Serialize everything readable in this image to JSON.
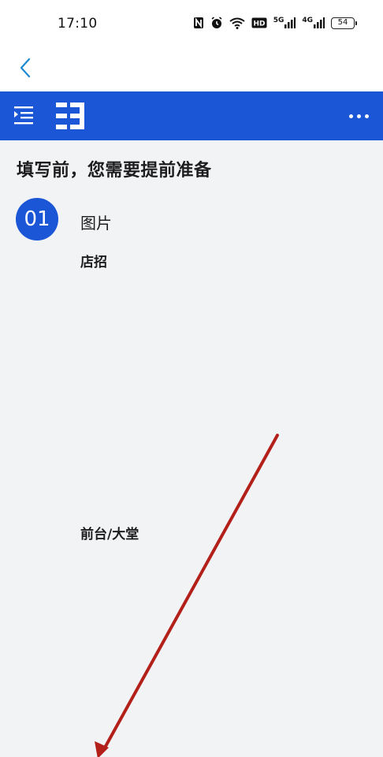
{
  "status_bar": {
    "time": "17:10",
    "icons": [
      "nfc-icon",
      "alarm-icon",
      "wifi-icon",
      "hd-icon",
      "signal-5g-icon",
      "signal-4g-icon",
      "battery-icon"
    ],
    "hd_label": "HD",
    "net1_label": "5G",
    "net2_label": "4G",
    "battery_level": "54"
  },
  "nav": {
    "back_icon": "chevron-left-icon",
    "accent_color": "#1a8ad4"
  },
  "toolbar": {
    "background_color": "#1a56d6",
    "menu_icon": "menu-indent-icon",
    "logo_icon": "app-logo-icon",
    "more_icon": "more-dots-icon"
  },
  "content": {
    "title": "填写前，您需要提前准备",
    "step": {
      "number": "01",
      "title": "图片",
      "items": [
        "店招",
        "前台/大堂"
      ]
    }
  },
  "annotation": {
    "color": "#b3201a",
    "shape": "red-arrow"
  }
}
